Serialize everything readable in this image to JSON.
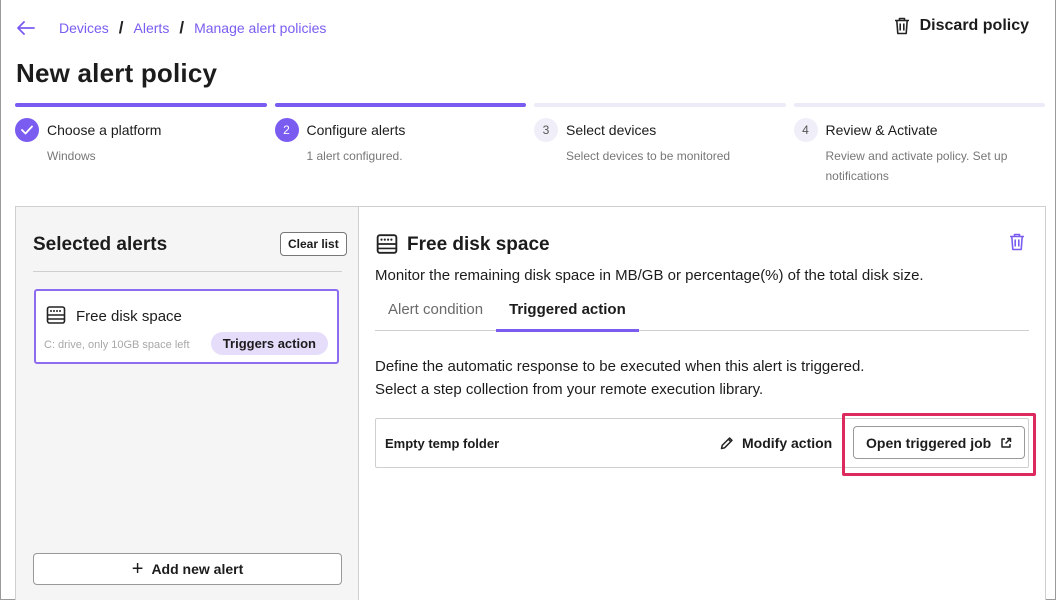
{
  "breadcrumbs": [
    "Devices",
    "Alerts",
    "Manage alert policies"
  ],
  "discard_label": "Discard policy",
  "page_title": "New alert policy",
  "steps": [
    {
      "num": "",
      "title": "Choose a platform",
      "sub": "Windows",
      "state": "done"
    },
    {
      "num": "2",
      "title": "Configure alerts",
      "sub": "1 alert configured.",
      "state": "current"
    },
    {
      "num": "3",
      "title": "Select devices",
      "sub": "Select devices to be monitored",
      "state": "todo"
    },
    {
      "num": "4",
      "title": "Review & Activate",
      "sub": "Review and activate policy. Set up notifications",
      "state": "todo"
    }
  ],
  "left": {
    "title": "Selected alerts",
    "clear_label": "Clear list",
    "card": {
      "name": "Free disk space",
      "sub": "C: drive, only 10GB space left",
      "badge": "Triggers action"
    },
    "add_label": "Add new alert"
  },
  "right": {
    "title": "Free disk space",
    "description": "Monitor the remaining disk space in MB/GB or percentage(%) of the total disk size.",
    "tabs": [
      {
        "label": "Alert condition",
        "active": false
      },
      {
        "label": "Triggered action",
        "active": true
      }
    ],
    "text_line1": "Define the automatic response to be executed when this alert is triggered.",
    "text_line2": "Select a step collection from your remote execution library.",
    "action_name": "Empty temp folder",
    "modify_label": "Modify action",
    "open_label": "Open triggered job"
  },
  "colors": {
    "accent": "#7b5cf0",
    "highlight": "#dd2a5e",
    "badge": "#e6ddfb"
  }
}
